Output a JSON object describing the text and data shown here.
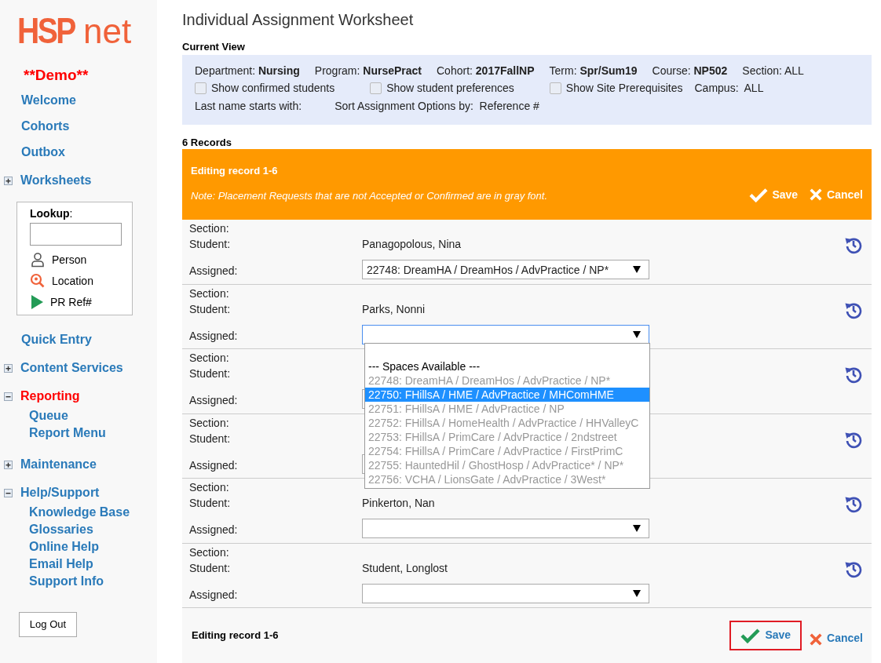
{
  "sidebar": {
    "logo": {
      "bold": "HSP",
      "light": "net"
    },
    "demo_label": "**Demo**",
    "items": [
      {
        "kind": "link",
        "label": "Welcome"
      },
      {
        "kind": "link",
        "label": "Cohorts"
      },
      {
        "kind": "link",
        "label": "Outbox"
      },
      {
        "kind": "group",
        "label": "Worksheets",
        "expanded": false,
        "selected": false
      },
      {
        "kind": "lookup",
        "label": "**Lookup**:",
        "links": [
          {
            "kind": "person",
            "label": "Person"
          },
          {
            "kind": "location",
            "label": "Location"
          },
          {
            "kind": "ref",
            "label": "PR Ref#"
          }
        ]
      },
      {
        "kind": "link",
        "label": "Quick Entry"
      },
      {
        "kind": "group",
        "label": "Content Services",
        "expanded": false,
        "selected": false
      },
      {
        "kind": "group",
        "label": "Reporting",
        "expanded": true,
        "selected": true,
        "children": [
          "Queue",
          "Report Menu"
        ]
      },
      {
        "kind": "group",
        "label": "Maintenance",
        "expanded": false,
        "selected": false
      },
      {
        "kind": "group",
        "label": "Help/Support",
        "expanded": true,
        "selected": false,
        "children": [
          "Knowledge Base",
          "Glossaries",
          "Online Help",
          "Email Help",
          "Support Info"
        ]
      }
    ],
    "logout": "Log Out"
  },
  "title": "Individual Assignment Worksheet",
  "current_view": {
    "heading": "Current View",
    "fields": [
      {
        "label": "Department:",
        "value": "Nursing",
        "emphasis": true
      },
      {
        "label": "Program:",
        "value": "NursePract",
        "emphasis": true
      },
      {
        "label": "Cohort:",
        "value": "2017FallNP",
        "emphasis": true
      },
      {
        "label": "Term:",
        "value": "Spr/Sum19",
        "emphasis": true
      },
      {
        "label": "Course:",
        "value": "NP502",
        "emphasis": true
      },
      {
        "label": "Section:",
        "value": "ALL",
        "emphasis": false
      }
    ],
    "checkboxes": [
      {
        "label": "Show confirmed students",
        "checked": false
      },
      {
        "label": "Show student preferences",
        "checked": false
      },
      {
        "label": "Show Site Prerequisites",
        "checked": false
      }
    ],
    "campus": {
      "label": "Campus:",
      "value": "ALL"
    },
    "last_name": {
      "label": "Last name starts with:"
    },
    "sort": {
      "label": "Sort Assignment Options by:",
      "value": "Reference #"
    }
  },
  "records_count": "6 Records",
  "banner": {
    "title": "Editing record 1-6",
    "note": "Note: Placement Requests that are not Accepted or Confirmed are in gray font.",
    "save": "Save",
    "cancel": "Cancel"
  },
  "records": [
    {
      "section_label": "Section:",
      "student_label": "Student:",
      "student": "Panagopolous, Nina",
      "assigned_label": "Assigned:",
      "assigned": "22748: DreamHA / DreamHos / AdvPractice / NP*",
      "open": false
    },
    {
      "section_label": "Section:",
      "student_label": "Student:",
      "student": "Parks, Nonni",
      "assigned_label": "Assigned:",
      "open": true,
      "options": [
        {
          "kind": "blank"
        },
        {
          "kind": "header",
          "label": "--- Spaces Available ---"
        },
        {
          "kind": "option",
          "label": "22748: DreamHA / DreamHos / AdvPractice / NP*",
          "accepted": false,
          "selected": false
        },
        {
          "kind": "option",
          "label": "22750: FHillsA / HME / AdvPractice / MHComHME",
          "selected": true
        },
        {
          "kind": "option",
          "label": "22751: FHillsA / HME / AdvPractice / NP",
          "accepted": false,
          "selected": false
        },
        {
          "kind": "option",
          "label": "22752: FHillsA / HomeHealth / AdvPractice / HHValleyC",
          "accepted": false,
          "selected": false
        },
        {
          "kind": "option",
          "label": "22753: FHillsA / PrimCare / AdvPractice / 2ndstreet",
          "accepted": false,
          "selected": false
        },
        {
          "kind": "option",
          "label": "22754: FHillsA / PrimCare / AdvPractice / FirstPrimC",
          "accepted": false,
          "selected": false
        },
        {
          "kind": "option",
          "label": "22755: HauntedHil / GhostHosp / AdvPractice* / NP*",
          "accepted": false,
          "selected": false
        },
        {
          "kind": "option",
          "label": "22756: VCHA / LionsGate / AdvPractice / 3West*",
          "accepted": false,
          "selected": false
        }
      ]
    },
    {
      "section_label": "Section:",
      "student_label": "Student:",
      "assigned_label": "Assigned:",
      "open": false
    },
    {
      "section_label": "Section:",
      "student_label": "Student:",
      "assigned_label": "Assigned:",
      "open": false
    },
    {
      "section_label": "Section:",
      "student_label": "Student:",
      "student": "Pinkerton, Nan",
      "assigned_label": "Assigned:",
      "open": false
    },
    {
      "section_label": "Section:",
      "student_label": "Student:",
      "student": "Student, Longlost",
      "assigned_label": "Assigned:",
      "open": false
    }
  ],
  "footer": {
    "title": "Editing record 1-6",
    "save": "Save",
    "cancel": "Cancel",
    "save_highlighted": true
  }
}
